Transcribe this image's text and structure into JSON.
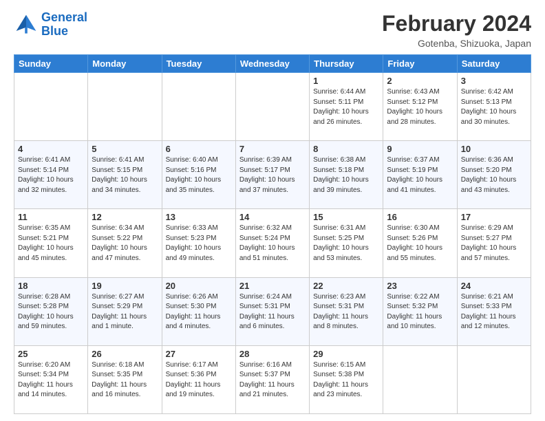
{
  "logo": {
    "line1": "General",
    "line2": "Blue"
  },
  "title": "February 2024",
  "subtitle": "Gotenba, Shizuoka, Japan",
  "days_of_week": [
    "Sunday",
    "Monday",
    "Tuesday",
    "Wednesday",
    "Thursday",
    "Friday",
    "Saturday"
  ],
  "weeks": [
    [
      {
        "num": "",
        "info": ""
      },
      {
        "num": "",
        "info": ""
      },
      {
        "num": "",
        "info": ""
      },
      {
        "num": "",
        "info": ""
      },
      {
        "num": "1",
        "info": "Sunrise: 6:44 AM\nSunset: 5:11 PM\nDaylight: 10 hours\nand 26 minutes."
      },
      {
        "num": "2",
        "info": "Sunrise: 6:43 AM\nSunset: 5:12 PM\nDaylight: 10 hours\nand 28 minutes."
      },
      {
        "num": "3",
        "info": "Sunrise: 6:42 AM\nSunset: 5:13 PM\nDaylight: 10 hours\nand 30 minutes."
      }
    ],
    [
      {
        "num": "4",
        "info": "Sunrise: 6:41 AM\nSunset: 5:14 PM\nDaylight: 10 hours\nand 32 minutes."
      },
      {
        "num": "5",
        "info": "Sunrise: 6:41 AM\nSunset: 5:15 PM\nDaylight: 10 hours\nand 34 minutes."
      },
      {
        "num": "6",
        "info": "Sunrise: 6:40 AM\nSunset: 5:16 PM\nDaylight: 10 hours\nand 35 minutes."
      },
      {
        "num": "7",
        "info": "Sunrise: 6:39 AM\nSunset: 5:17 PM\nDaylight: 10 hours\nand 37 minutes."
      },
      {
        "num": "8",
        "info": "Sunrise: 6:38 AM\nSunset: 5:18 PM\nDaylight: 10 hours\nand 39 minutes."
      },
      {
        "num": "9",
        "info": "Sunrise: 6:37 AM\nSunset: 5:19 PM\nDaylight: 10 hours\nand 41 minutes."
      },
      {
        "num": "10",
        "info": "Sunrise: 6:36 AM\nSunset: 5:20 PM\nDaylight: 10 hours\nand 43 minutes."
      }
    ],
    [
      {
        "num": "11",
        "info": "Sunrise: 6:35 AM\nSunset: 5:21 PM\nDaylight: 10 hours\nand 45 minutes."
      },
      {
        "num": "12",
        "info": "Sunrise: 6:34 AM\nSunset: 5:22 PM\nDaylight: 10 hours\nand 47 minutes."
      },
      {
        "num": "13",
        "info": "Sunrise: 6:33 AM\nSunset: 5:23 PM\nDaylight: 10 hours\nand 49 minutes."
      },
      {
        "num": "14",
        "info": "Sunrise: 6:32 AM\nSunset: 5:24 PM\nDaylight: 10 hours\nand 51 minutes."
      },
      {
        "num": "15",
        "info": "Sunrise: 6:31 AM\nSunset: 5:25 PM\nDaylight: 10 hours\nand 53 minutes."
      },
      {
        "num": "16",
        "info": "Sunrise: 6:30 AM\nSunset: 5:26 PM\nDaylight: 10 hours\nand 55 minutes."
      },
      {
        "num": "17",
        "info": "Sunrise: 6:29 AM\nSunset: 5:27 PM\nDaylight: 10 hours\nand 57 minutes."
      }
    ],
    [
      {
        "num": "18",
        "info": "Sunrise: 6:28 AM\nSunset: 5:28 PM\nDaylight: 10 hours\nand 59 minutes."
      },
      {
        "num": "19",
        "info": "Sunrise: 6:27 AM\nSunset: 5:29 PM\nDaylight: 11 hours\nand 1 minute."
      },
      {
        "num": "20",
        "info": "Sunrise: 6:26 AM\nSunset: 5:30 PM\nDaylight: 11 hours\nand 4 minutes."
      },
      {
        "num": "21",
        "info": "Sunrise: 6:24 AM\nSunset: 5:31 PM\nDaylight: 11 hours\nand 6 minutes."
      },
      {
        "num": "22",
        "info": "Sunrise: 6:23 AM\nSunset: 5:31 PM\nDaylight: 11 hours\nand 8 minutes."
      },
      {
        "num": "23",
        "info": "Sunrise: 6:22 AM\nSunset: 5:32 PM\nDaylight: 11 hours\nand 10 minutes."
      },
      {
        "num": "24",
        "info": "Sunrise: 6:21 AM\nSunset: 5:33 PM\nDaylight: 11 hours\nand 12 minutes."
      }
    ],
    [
      {
        "num": "25",
        "info": "Sunrise: 6:20 AM\nSunset: 5:34 PM\nDaylight: 11 hours\nand 14 minutes."
      },
      {
        "num": "26",
        "info": "Sunrise: 6:18 AM\nSunset: 5:35 PM\nDaylight: 11 hours\nand 16 minutes."
      },
      {
        "num": "27",
        "info": "Sunrise: 6:17 AM\nSunset: 5:36 PM\nDaylight: 11 hours\nand 19 minutes."
      },
      {
        "num": "28",
        "info": "Sunrise: 6:16 AM\nSunset: 5:37 PM\nDaylight: 11 hours\nand 21 minutes."
      },
      {
        "num": "29",
        "info": "Sunrise: 6:15 AM\nSunset: 5:38 PM\nDaylight: 11 hours\nand 23 minutes."
      },
      {
        "num": "",
        "info": ""
      },
      {
        "num": "",
        "info": ""
      }
    ]
  ]
}
